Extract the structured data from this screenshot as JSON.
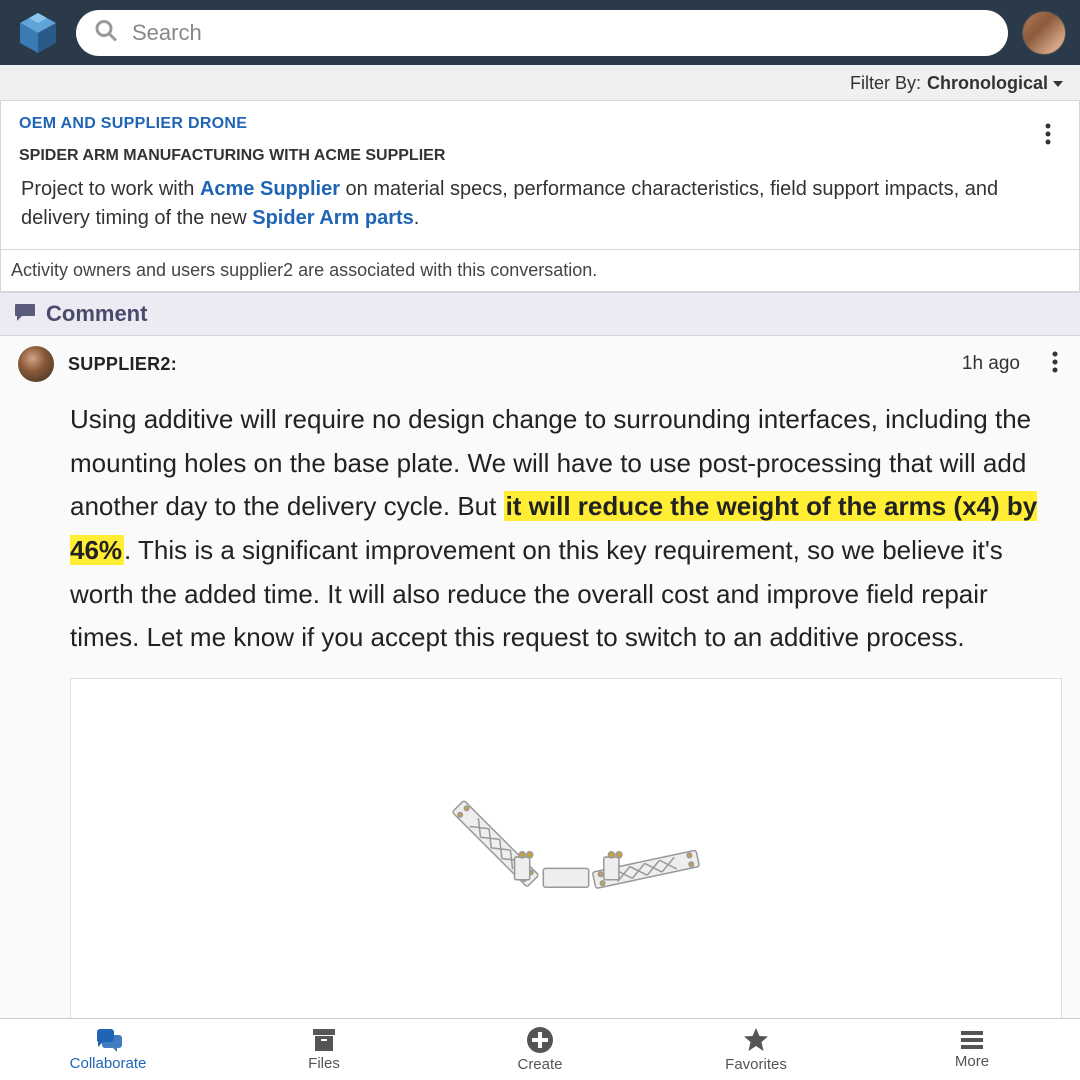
{
  "header": {
    "search_placeholder": "Search"
  },
  "filter": {
    "label": "Filter By:",
    "value": "Chronological"
  },
  "thread": {
    "breadcrumb": "OEM AND SUPPLIER DRONE",
    "title": "SPIDER ARM MANUFACTURING WITH ACME SUPPLIER",
    "desc_prefix": "Project to work with ",
    "desc_link1": "Acme Supplier",
    "desc_mid": " on material specs, performance characteristics, field support impacts, and delivery timing of the new ",
    "desc_link2": "Spider Arm parts",
    "desc_suffix": ".",
    "association_text": "Activity owners and users supplier2 are associated with this conversation."
  },
  "comment_action": {
    "label": "Comment"
  },
  "post": {
    "author": "SUPPLIER2:",
    "time": "1h ago",
    "text_before": "Using additive will require no design change to surrounding interfaces, including the mounting holes on the base plate. We will have to use post-processing that will add another day to the delivery cycle. But ",
    "highlight": "it will reduce the weight of the arms (x4) by 46%",
    "text_after": ". This is a significant improvement on this key requirement, so we believe it's worth the added time. It will also reduce the overall cost and improve field repair times. Let me know if you accept this request to switch to an additive process."
  },
  "nav": {
    "collaborate": "Collaborate",
    "files": "Files",
    "create": "Create",
    "favorites": "Favorites",
    "more": "More"
  }
}
